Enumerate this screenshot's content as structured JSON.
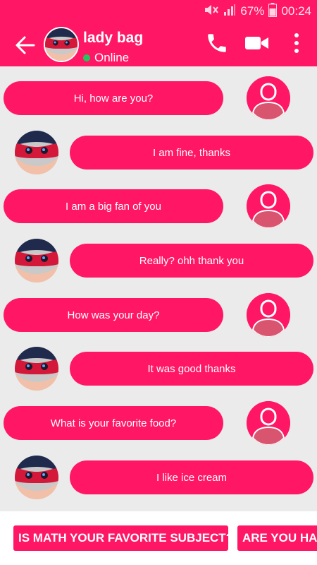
{
  "status_bar": {
    "battery_percent": "67%",
    "time": "00:24",
    "icons": [
      "mute-icon",
      "signal-icon",
      "battery-icon"
    ]
  },
  "header": {
    "contact_name": "lady bag",
    "status": "Online",
    "icons": {
      "back": "arrow-left-icon",
      "call": "phone-icon",
      "video": "video-camera-icon",
      "menu": "more-vertical-icon"
    }
  },
  "messages": [
    {
      "sender": "user",
      "text": "Hi, how are you?"
    },
    {
      "sender": "bot",
      "text": "I am fine, thanks"
    },
    {
      "sender": "user",
      "text": "I am a big fan of you"
    },
    {
      "sender": "bot",
      "text": "Really? ohh thank you"
    },
    {
      "sender": "user",
      "text": "How was your day?"
    },
    {
      "sender": "bot",
      "text": "It was good thanks"
    },
    {
      "sender": "user",
      "text": "What is your favorite food?"
    },
    {
      "sender": "bot",
      "text": "I like ice cream"
    }
  ],
  "suggestions": [
    {
      "label": "IS MATH YOUR FAVORITE SUBJECT?"
    },
    {
      "label": "ARE YOU HA"
    }
  ],
  "colors": {
    "accent": "#ff1766",
    "user_avatar_figure": "#d9556f",
    "background": "#ebebeb",
    "online": "#22c55e"
  }
}
